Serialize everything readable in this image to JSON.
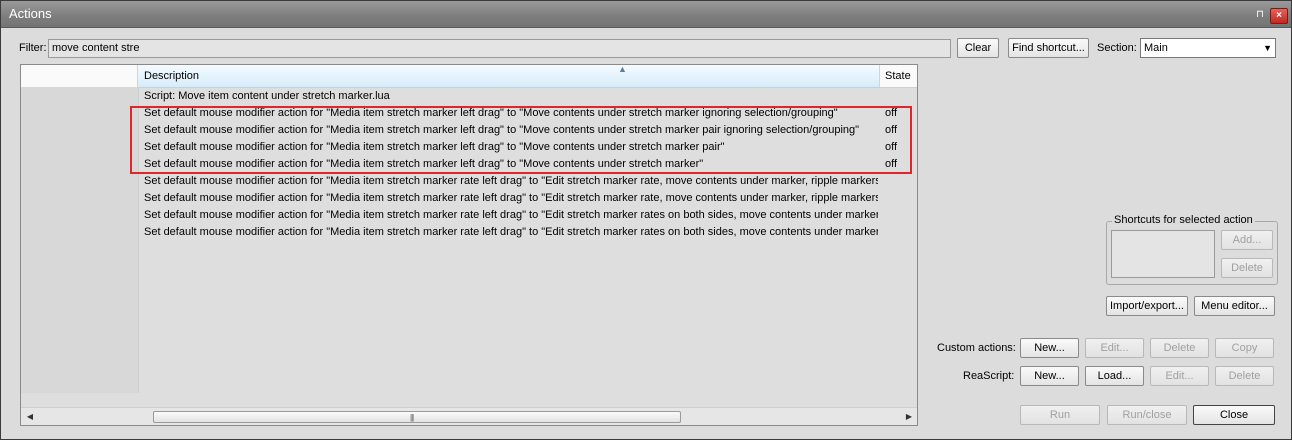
{
  "window": {
    "title": "Actions",
    "pin_icon": "pin-icon",
    "close_icon": "close-icon"
  },
  "toolbar": {
    "filter_label": "Filter:",
    "filter_value": "move content stre",
    "clear_label": "Clear",
    "find_shortcut_label": "Find shortcut...",
    "section_label": "Section:",
    "section_value": "Main"
  },
  "list": {
    "columns": {
      "description": "Description",
      "state": "State"
    },
    "rows": [
      {
        "description": "Script: Move item content under stretch marker.lua",
        "state": ""
      },
      {
        "description": "Set default mouse modifier action for \"Media item stretch marker left drag\" to \"Move contents under stretch marker ignoring selection/grouping\"",
        "state": "off"
      },
      {
        "description": "Set default mouse modifier action for \"Media item stretch marker left drag\" to \"Move contents under stretch marker pair ignoring selection/grouping\"",
        "state": "off"
      },
      {
        "description": "Set default mouse modifier action for \"Media item stretch marker left drag\" to \"Move contents under stretch marker pair\"",
        "state": "off"
      },
      {
        "description": "Set default mouse modifier action for \"Media item stretch marker left drag\" to \"Move contents under stretch marker\"",
        "state": "off"
      },
      {
        "description": "Set default mouse modifier action for \"Media item stretch marker rate left drag\" to \"Edit stretch marker rate, move contents under marker, ripple markers\"",
        "state": ""
      },
      {
        "description": "Set default mouse modifier action for \"Media item stretch marker rate left drag\" to \"Edit stretch marker rate, move contents under marker, ripple markers, i...",
        "state": ""
      },
      {
        "description": "Set default mouse modifier action for \"Media item stretch marker rate left drag\" to \"Edit stretch marker rates on both sides, move contents under marker, i...",
        "state": ""
      },
      {
        "description": "Set default mouse modifier action for \"Media item stretch marker rate left drag\" to \"Edit stretch marker rates on both sides, move contents under marker, ri...",
        "state": ""
      }
    ],
    "highlight_color": "#e0262b"
  },
  "shortcuts": {
    "group_title": "Shortcuts for selected action",
    "add_label": "Add...",
    "delete_label": "Delete"
  },
  "import_export_label": "Import/export...",
  "menu_editor_label": "Menu editor...",
  "custom_actions": {
    "label": "Custom actions:",
    "new_label": "New...",
    "edit_label": "Edit...",
    "delete_label": "Delete",
    "copy_label": "Copy"
  },
  "reascript": {
    "label": "ReaScript:",
    "new_label": "New...",
    "load_label": "Load...",
    "edit_label": "Edit...",
    "delete_label": "Delete"
  },
  "footer": {
    "run_label": "Run",
    "run_close_label": "Run/close",
    "close_label": "Close"
  }
}
